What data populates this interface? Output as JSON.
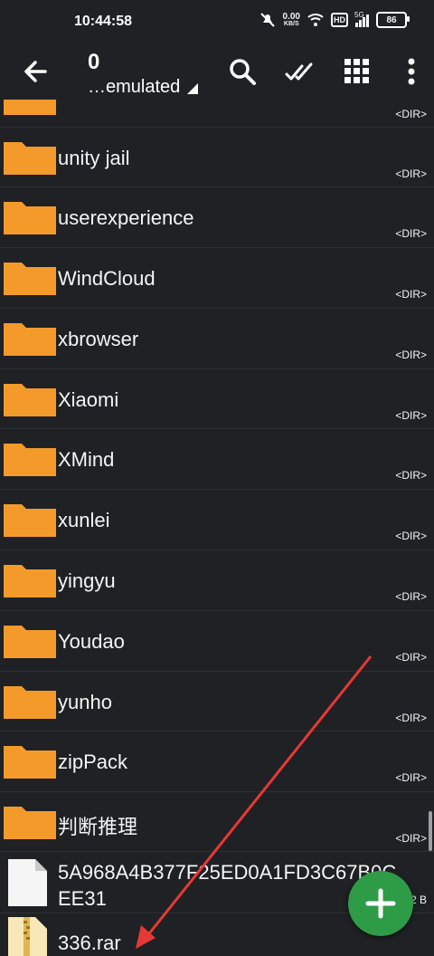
{
  "status": {
    "time": "10:44:58",
    "speed_value": "0.00",
    "speed_unit": "KB/S",
    "hd": "HD",
    "network": "5G",
    "battery": "86"
  },
  "toolbar": {
    "count": "0",
    "path": "…emulated",
    "icons": [
      "back-icon",
      "search-icon",
      "select-all-icon",
      "grid-icon",
      "more-icon"
    ]
  },
  "folders": [
    {
      "name": "unity jail",
      "meta": "<DIR>"
    },
    {
      "name": "userexperience",
      "meta": "<DIR>"
    },
    {
      "name": "WindCloud",
      "meta": "<DIR>"
    },
    {
      "name": "xbrowser",
      "meta": "<DIR>"
    },
    {
      "name": "Xiaomi",
      "meta": "<DIR>"
    },
    {
      "name": "XMind",
      "meta": "<DIR>"
    },
    {
      "name": "xunlei",
      "meta": "<DIR>"
    },
    {
      "name": "yingyu",
      "meta": "<DIR>"
    },
    {
      "name": "Youdao",
      "meta": "<DIR>"
    },
    {
      "name": "yunho",
      "meta": "<DIR>"
    },
    {
      "name": "zipPack",
      "meta": "<DIR>"
    },
    {
      "name": "判断推理",
      "meta": "<DIR>"
    }
  ],
  "partial_top": {
    "meta": "<DIR>"
  },
  "files": [
    {
      "name": "5A968A4B377F25ED0A1FD3C67B0CEE31",
      "meta": "2 B"
    },
    {
      "name": "336.rar",
      "meta": ""
    }
  ],
  "colors": {
    "background": "#202124",
    "folder": "#f39a2b",
    "fab": "#2e9b47",
    "annotation_arrow": "#e53935"
  }
}
